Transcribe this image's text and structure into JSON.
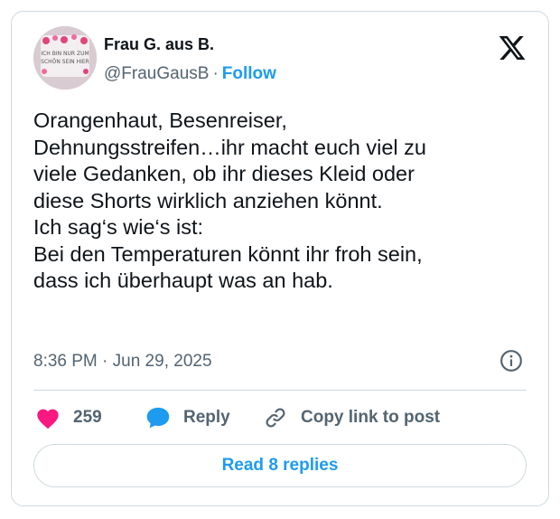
{
  "author": {
    "display_name": "Frau G. aus B.",
    "handle": "@FrauGausB",
    "separator": "·",
    "follow_label": "Follow"
  },
  "avatar_image_text": [
    "ICH BIN NUR ZUM",
    "SCHÖN SEIN HIER"
  ],
  "tweet": {
    "lines": [
      "Orangenhaut, Besenreiser,",
      "Dehnungsstreifen…ihr macht euch viel zu",
      "viele Gedanken, ob ihr dieses Kleid oder",
      "diese Shorts wirklich anziehen könnt.",
      "Ich sag‘s wie‘s ist:",
      "Bei den Temperaturen könnt ihr froh sein,",
      "dass ich überhaupt was an hab."
    ],
    "timestamp": "8:36 PM · Jun 29, 2025"
  },
  "actions": {
    "like_count": "259",
    "reply_label": "Reply",
    "copy_link_label": "Copy link to post"
  },
  "read_replies_label": "Read 8 replies",
  "icons": {
    "brand": "x-logo-icon",
    "info": "info-icon",
    "like": "heart-icon",
    "reply": "speech-bubble-icon",
    "copy": "link-icon"
  },
  "colors": {
    "accent": "#1d9bf0",
    "like": "#f91880",
    "text": "#0f1419",
    "secondary": "#536471",
    "border": "#cfd9de"
  }
}
